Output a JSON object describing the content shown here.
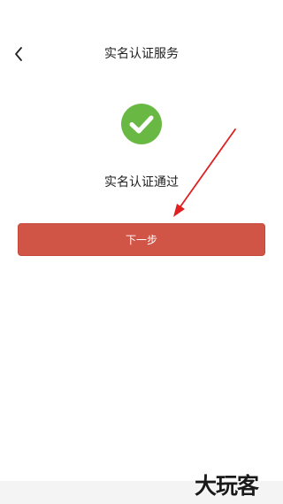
{
  "header": {
    "title": "实名认证服务",
    "back_icon": "chevron-left-icon"
  },
  "status": {
    "icon": "check-circle-icon",
    "icon_color": "#6ab844",
    "text": "实名认证通过"
  },
  "actions": {
    "next_label": "下一步",
    "button_color": "#d05547"
  },
  "annotation": {
    "arrow_color": "#e02020"
  },
  "watermark": {
    "text": "大玩客"
  }
}
